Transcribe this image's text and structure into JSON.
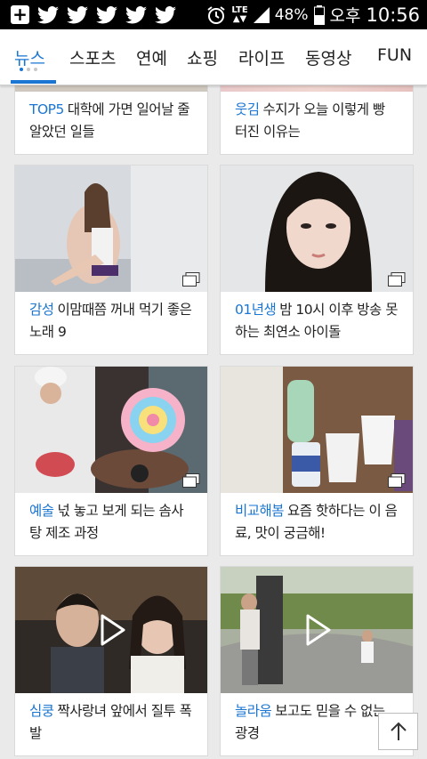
{
  "status": {
    "network": "LTE",
    "battery": "48%",
    "ampm": "오후",
    "time": "10:56"
  },
  "tabs": [
    {
      "label": "뉴스"
    },
    {
      "label": "스포츠"
    },
    {
      "label": "연예"
    },
    {
      "label": "쇼핑"
    },
    {
      "label": "라이프"
    },
    {
      "label": "동영상"
    },
    {
      "label": "FUN"
    }
  ],
  "cards": [
    {
      "tag": "TOP5",
      "text": "대학에 가면 일어날 줄 알았던 일들"
    },
    {
      "tag": "웃김",
      "text": "수지가 오늘 이렇게 빵 터진 이유는"
    },
    {
      "tag": "감성",
      "text": "이맘때쯤 꺼내 먹기 좋은 노래 9",
      "media": "gallery-icon"
    },
    {
      "tag": "01년생",
      "text": "밤 10시 이후 방송 못하는 최연소 아이돌",
      "media": "gallery-icon"
    },
    {
      "tag": "예술",
      "text": "넋 놓고 보게 되는 솜사탕 제조 과정",
      "media": "gallery-icon"
    },
    {
      "tag": "비교해봄",
      "text": "요즘 핫하다는 이 음료, 맛이 궁금해!",
      "media": "gallery-icon"
    },
    {
      "tag": "심쿵",
      "text": "짝사랑녀 앞에서 질투 폭발",
      "media": "play-icon"
    },
    {
      "tag": "놀라움",
      "text": "보고도 믿을 수 없는 광경",
      "media": "play-icon"
    }
  ],
  "colors": {
    "accent": "#1a76d2",
    "background": "#eaeaea"
  }
}
